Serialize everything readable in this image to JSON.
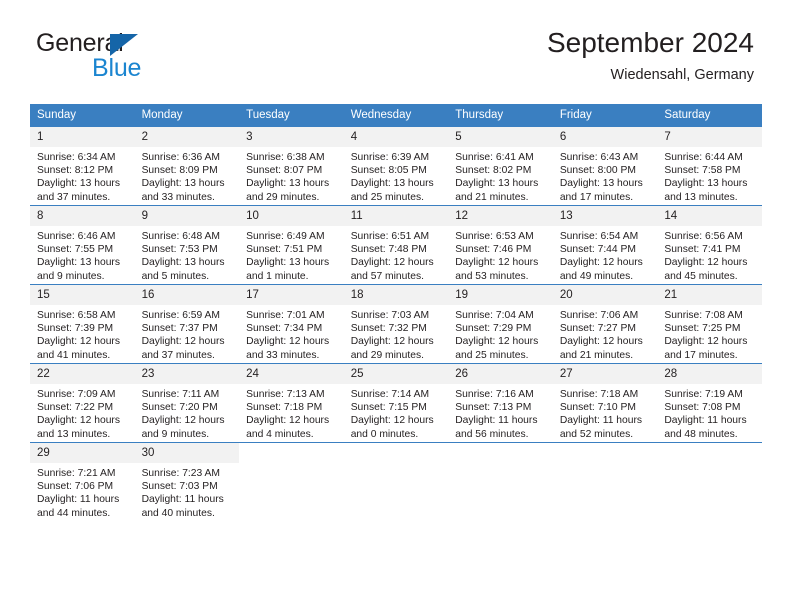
{
  "brand": {
    "name_part1": "General",
    "name_part2": "Blue",
    "triangle_color": "#1565a8",
    "blue_color": "#1b85d0"
  },
  "header": {
    "title": "September 2024",
    "location": "Wiedensahl, Germany"
  },
  "theme": {
    "header_blue": "#3a7fc1",
    "daynum_band": "#f2f2f2",
    "text": "#231f20"
  },
  "weekday_headers": [
    "Sunday",
    "Monday",
    "Tuesday",
    "Wednesday",
    "Thursday",
    "Friday",
    "Saturday"
  ],
  "weeks": [
    [
      {
        "day": "1",
        "sunrise": "Sunrise: 6:34 AM",
        "sunset": "Sunset: 8:12 PM",
        "daylight1": "Daylight: 13 hours",
        "daylight2": "and 37 minutes."
      },
      {
        "day": "2",
        "sunrise": "Sunrise: 6:36 AM",
        "sunset": "Sunset: 8:09 PM",
        "daylight1": "Daylight: 13 hours",
        "daylight2": "and 33 minutes."
      },
      {
        "day": "3",
        "sunrise": "Sunrise: 6:38 AM",
        "sunset": "Sunset: 8:07 PM",
        "daylight1": "Daylight: 13 hours",
        "daylight2": "and 29 minutes."
      },
      {
        "day": "4",
        "sunrise": "Sunrise: 6:39 AM",
        "sunset": "Sunset: 8:05 PM",
        "daylight1": "Daylight: 13 hours",
        "daylight2": "and 25 minutes."
      },
      {
        "day": "5",
        "sunrise": "Sunrise: 6:41 AM",
        "sunset": "Sunset: 8:02 PM",
        "daylight1": "Daylight: 13 hours",
        "daylight2": "and 21 minutes."
      },
      {
        "day": "6",
        "sunrise": "Sunrise: 6:43 AM",
        "sunset": "Sunset: 8:00 PM",
        "daylight1": "Daylight: 13 hours",
        "daylight2": "and 17 minutes."
      },
      {
        "day": "7",
        "sunrise": "Sunrise: 6:44 AM",
        "sunset": "Sunset: 7:58 PM",
        "daylight1": "Daylight: 13 hours",
        "daylight2": "and 13 minutes."
      }
    ],
    [
      {
        "day": "8",
        "sunrise": "Sunrise: 6:46 AM",
        "sunset": "Sunset: 7:55 PM",
        "daylight1": "Daylight: 13 hours",
        "daylight2": "and 9 minutes."
      },
      {
        "day": "9",
        "sunrise": "Sunrise: 6:48 AM",
        "sunset": "Sunset: 7:53 PM",
        "daylight1": "Daylight: 13 hours",
        "daylight2": "and 5 minutes."
      },
      {
        "day": "10",
        "sunrise": "Sunrise: 6:49 AM",
        "sunset": "Sunset: 7:51 PM",
        "daylight1": "Daylight: 13 hours",
        "daylight2": "and 1 minute."
      },
      {
        "day": "11",
        "sunrise": "Sunrise: 6:51 AM",
        "sunset": "Sunset: 7:48 PM",
        "daylight1": "Daylight: 12 hours",
        "daylight2": "and 57 minutes."
      },
      {
        "day": "12",
        "sunrise": "Sunrise: 6:53 AM",
        "sunset": "Sunset: 7:46 PM",
        "daylight1": "Daylight: 12 hours",
        "daylight2": "and 53 minutes."
      },
      {
        "day": "13",
        "sunrise": "Sunrise: 6:54 AM",
        "sunset": "Sunset: 7:44 PM",
        "daylight1": "Daylight: 12 hours",
        "daylight2": "and 49 minutes."
      },
      {
        "day": "14",
        "sunrise": "Sunrise: 6:56 AM",
        "sunset": "Sunset: 7:41 PM",
        "daylight1": "Daylight: 12 hours",
        "daylight2": "and 45 minutes."
      }
    ],
    [
      {
        "day": "15",
        "sunrise": "Sunrise: 6:58 AM",
        "sunset": "Sunset: 7:39 PM",
        "daylight1": "Daylight: 12 hours",
        "daylight2": "and 41 minutes."
      },
      {
        "day": "16",
        "sunrise": "Sunrise: 6:59 AM",
        "sunset": "Sunset: 7:37 PM",
        "daylight1": "Daylight: 12 hours",
        "daylight2": "and 37 minutes."
      },
      {
        "day": "17",
        "sunrise": "Sunrise: 7:01 AM",
        "sunset": "Sunset: 7:34 PM",
        "daylight1": "Daylight: 12 hours",
        "daylight2": "and 33 minutes."
      },
      {
        "day": "18",
        "sunrise": "Sunrise: 7:03 AM",
        "sunset": "Sunset: 7:32 PM",
        "daylight1": "Daylight: 12 hours",
        "daylight2": "and 29 minutes."
      },
      {
        "day": "19",
        "sunrise": "Sunrise: 7:04 AM",
        "sunset": "Sunset: 7:29 PM",
        "daylight1": "Daylight: 12 hours",
        "daylight2": "and 25 minutes."
      },
      {
        "day": "20",
        "sunrise": "Sunrise: 7:06 AM",
        "sunset": "Sunset: 7:27 PM",
        "daylight1": "Daylight: 12 hours",
        "daylight2": "and 21 minutes."
      },
      {
        "day": "21",
        "sunrise": "Sunrise: 7:08 AM",
        "sunset": "Sunset: 7:25 PM",
        "daylight1": "Daylight: 12 hours",
        "daylight2": "and 17 minutes."
      }
    ],
    [
      {
        "day": "22",
        "sunrise": "Sunrise: 7:09 AM",
        "sunset": "Sunset: 7:22 PM",
        "daylight1": "Daylight: 12 hours",
        "daylight2": "and 13 minutes."
      },
      {
        "day": "23",
        "sunrise": "Sunrise: 7:11 AM",
        "sunset": "Sunset: 7:20 PM",
        "daylight1": "Daylight: 12 hours",
        "daylight2": "and 9 minutes."
      },
      {
        "day": "24",
        "sunrise": "Sunrise: 7:13 AM",
        "sunset": "Sunset: 7:18 PM",
        "daylight1": "Daylight: 12 hours",
        "daylight2": "and 4 minutes."
      },
      {
        "day": "25",
        "sunrise": "Sunrise: 7:14 AM",
        "sunset": "Sunset: 7:15 PM",
        "daylight1": "Daylight: 12 hours",
        "daylight2": "and 0 minutes."
      },
      {
        "day": "26",
        "sunrise": "Sunrise: 7:16 AM",
        "sunset": "Sunset: 7:13 PM",
        "daylight1": "Daylight: 11 hours",
        "daylight2": "and 56 minutes."
      },
      {
        "day": "27",
        "sunrise": "Sunrise: 7:18 AM",
        "sunset": "Sunset: 7:10 PM",
        "daylight1": "Daylight: 11 hours",
        "daylight2": "and 52 minutes."
      },
      {
        "day": "28",
        "sunrise": "Sunrise: 7:19 AM",
        "sunset": "Sunset: 7:08 PM",
        "daylight1": "Daylight: 11 hours",
        "daylight2": "and 48 minutes."
      }
    ],
    [
      {
        "day": "29",
        "sunrise": "Sunrise: 7:21 AM",
        "sunset": "Sunset: 7:06 PM",
        "daylight1": "Daylight: 11 hours",
        "daylight2": "and 44 minutes."
      },
      {
        "day": "30",
        "sunrise": "Sunrise: 7:23 AM",
        "sunset": "Sunset: 7:03 PM",
        "daylight1": "Daylight: 11 hours",
        "daylight2": "and 40 minutes."
      },
      {
        "day": "",
        "sunrise": "",
        "sunset": "",
        "daylight1": "",
        "daylight2": ""
      },
      {
        "day": "",
        "sunrise": "",
        "sunset": "",
        "daylight1": "",
        "daylight2": ""
      },
      {
        "day": "",
        "sunrise": "",
        "sunset": "",
        "daylight1": "",
        "daylight2": ""
      },
      {
        "day": "",
        "sunrise": "",
        "sunset": "",
        "daylight1": "",
        "daylight2": ""
      },
      {
        "day": "",
        "sunrise": "",
        "sunset": "",
        "daylight1": "",
        "daylight2": ""
      }
    ]
  ]
}
